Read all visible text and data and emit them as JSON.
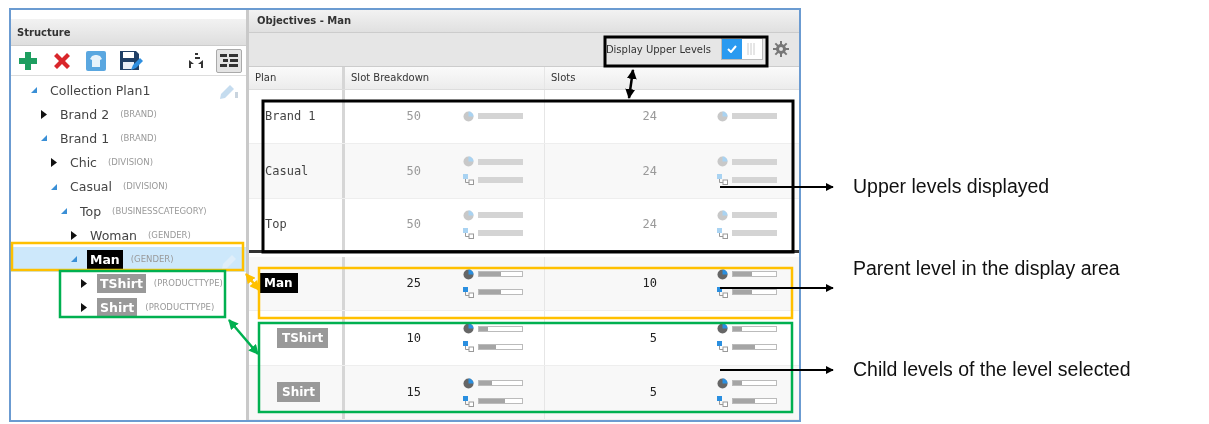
{
  "structure": {
    "title": "Structure",
    "tree": [
      {
        "label": "Collection Plan1",
        "kind": "node",
        "expanded": true,
        "selected": false,
        "children": [
          {
            "label": "Brand 2",
            "type": "(BRAND)",
            "kind": "node",
            "expanded": false,
            "selected": false
          },
          {
            "label": "Brand 1",
            "type": "(BRAND)",
            "kind": "node",
            "expanded": true,
            "selected": false,
            "children": [
              {
                "label": "Chic",
                "type": "(DIVISION)",
                "kind": "node",
                "expanded": false,
                "selected": false
              },
              {
                "label": "Casual",
                "type": "(DIVISION)",
                "kind": "node",
                "expanded": true,
                "selected": false,
                "children": [
                  {
                    "label": "Top",
                    "type": "(BUSINESSCATEGORY)",
                    "kind": "node",
                    "expanded": true,
                    "selected": false,
                    "children": [
                      {
                        "label": "Woman",
                        "type": "(GENDER)",
                        "kind": "node",
                        "expanded": false,
                        "selected": false
                      },
                      {
                        "label": "Man",
                        "type": "(GENDER)",
                        "kind": "current",
                        "expanded": true,
                        "selected": true,
                        "children": [
                          {
                            "label": "TShirt",
                            "type": "(PRODUCTTYPE)",
                            "kind": "child",
                            "expanded": false,
                            "selected": false
                          },
                          {
                            "label": "Shirt",
                            "type": "(PRODUCTTYPE)",
                            "kind": "child",
                            "expanded": false,
                            "selected": false
                          }
                        ]
                      }
                    ]
                  }
                ]
              }
            ]
          }
        ]
      }
    ]
  },
  "objectives": {
    "title": "Objectives - Man",
    "upper_levels_toggle": {
      "label": "Display Upper Levels",
      "on": true
    },
    "columns": [
      "Plan",
      "Slot Breakdown",
      "Slots"
    ],
    "rows": [
      {
        "kind": "upper",
        "plan": "Brand 1",
        "slot_breakdown": {
          "value": "50",
          "bars": [
            {
              "kind": "pie"
            }
          ]
        },
        "slots": {
          "value": "24",
          "bars": [
            {
              "kind": "pie"
            }
          ]
        }
      },
      {
        "kind": "upper",
        "plan": "Casual",
        "slot_breakdown": {
          "value": "50",
          "bars": [
            {
              "kind": "pie"
            },
            {
              "kind": "tree"
            }
          ]
        },
        "slots": {
          "value": "24",
          "bars": [
            {
              "kind": "pie"
            },
            {
              "kind": "tree"
            }
          ]
        }
      },
      {
        "kind": "upper",
        "plan": "Top",
        "slot_breakdown": {
          "value": "50",
          "bars": [
            {
              "kind": "pie"
            },
            {
              "kind": "tree"
            }
          ]
        },
        "slots": {
          "value": "24",
          "bars": [
            {
              "kind": "pie"
            },
            {
              "kind": "tree"
            }
          ]
        }
      },
      {
        "kind": "parent",
        "plan": "Man",
        "slot_breakdown": {
          "value": "25",
          "bars": [
            {
              "kind": "pie",
              "level": 0.5
            },
            {
              "kind": "tree",
              "level": 0.5
            }
          ]
        },
        "slots": {
          "value": "10",
          "bars": [
            {
              "kind": "pie",
              "level": 0.45
            },
            {
              "kind": "tree",
              "level": 0.45
            }
          ]
        }
      },
      {
        "kind": "child",
        "plan": "TShirt",
        "slot_breakdown": {
          "value": "10",
          "bars": [
            {
              "kind": "pie",
              "level": 0.2
            },
            {
              "kind": "tree",
              "level": 0.4
            }
          ]
        },
        "slots": {
          "value": "5",
          "bars": [
            {
              "kind": "pie",
              "level": 0.2
            },
            {
              "kind": "tree",
              "level": 0.5
            }
          ]
        }
      },
      {
        "kind": "child",
        "plan": "Shirt",
        "slot_breakdown": {
          "value": "15",
          "bars": [
            {
              "kind": "pie",
              "level": 0.3
            },
            {
              "kind": "tree",
              "level": 0.6
            }
          ]
        },
        "slots": {
          "value": "5",
          "bars": [
            {
              "kind": "pie",
              "level": 0.2
            },
            {
              "kind": "tree",
              "level": 0.5
            }
          ]
        }
      }
    ]
  },
  "annotations": [
    {
      "text": "Upper levels displayed"
    },
    {
      "text": "Parent level in the display area"
    },
    {
      "text": "Child levels of the level selected"
    }
  ]
}
